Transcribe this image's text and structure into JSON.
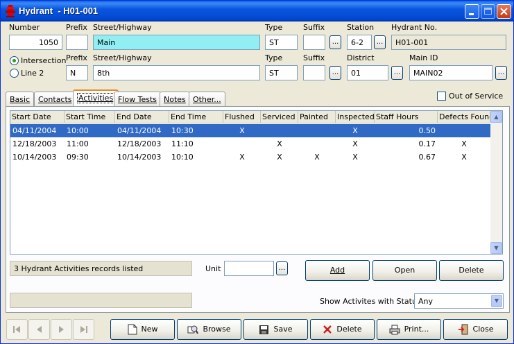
{
  "window": {
    "title": "Hydrant  - H01-001"
  },
  "row1": {
    "number_label": "Number",
    "number_value": "1050",
    "prefix_label": "Prefix",
    "prefix_value": "",
    "street_label": "Street/Highway",
    "street_value": "Main",
    "type_label": "Type",
    "type_value": "ST",
    "suffix_label": "Suffix",
    "suffix_value": "",
    "station_label": "Station",
    "station_value": "6-2",
    "hydrant_no_label": "Hydrant No.",
    "hydrant_no_value": "H01-001"
  },
  "row2": {
    "intersection_label": "Intersection",
    "line2_label": "Line 2",
    "prefix_label": "Prefix",
    "prefix_value": "N",
    "street_label": "Street/Highway",
    "street_value": "8th",
    "type_label": "Type",
    "type_value": "ST",
    "suffix_label": "Suffix",
    "suffix_value": "",
    "district_label": "District",
    "district_value": "01",
    "main_id_label": "Main ID",
    "main_id_value": "MAIN02"
  },
  "ellipsis": "...",
  "out_of_service_label": "Out of Service",
  "tabs": [
    "Basic",
    "Contacts",
    "Activities",
    "Flow Tests",
    "Notes",
    "Other..."
  ],
  "grid": {
    "columns": [
      "Start Date",
      "Start Time",
      "End Date",
      "End Time",
      "Flushed",
      "Serviced",
      "Painted",
      "Inspected",
      "Staff Hours",
      "Defects Found"
    ],
    "rows": [
      {
        "start_date": "04/11/2004",
        "start_time": "10:00",
        "end_date": "04/11/2004",
        "end_time": "10:30",
        "flushed": "X",
        "serviced": "",
        "painted": "",
        "inspected": "X",
        "staff_hours": "0.50",
        "defects": ""
      },
      {
        "start_date": "12/18/2003",
        "start_time": "11:00",
        "end_date": "12/18/2003",
        "end_time": "11:10",
        "flushed": "",
        "serviced": "X",
        "painted": "",
        "inspected": "X",
        "staff_hours": "0.17",
        "defects": "X"
      },
      {
        "start_date": "10/14/2003",
        "start_time": "09:30",
        "end_date": "10/14/2003",
        "end_time": "10:10",
        "flushed": "X",
        "serviced": "X",
        "painted": "X",
        "inspected": "X",
        "staff_hours": "0.67",
        "defects": "X"
      }
    ]
  },
  "records_status": "3 Hydrant Activities records listed",
  "unit_label": "Unit",
  "unit_value": "",
  "buttons": {
    "add": "Add",
    "open": "Open",
    "delete": "Delete"
  },
  "show_status_label": "Show Activites with Status",
  "show_status_value": "Any",
  "footer": {
    "new": "New",
    "browse": "Browse",
    "save": "Save",
    "delete": "Delete",
    "print": "Print...",
    "close": "Close"
  }
}
